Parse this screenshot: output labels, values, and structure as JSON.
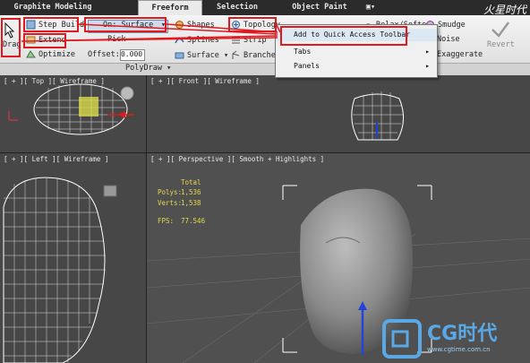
{
  "tabs": [
    {
      "label": "Graphite Modeling Tools",
      "active": false
    },
    {
      "label": "Freeform",
      "active": true
    },
    {
      "label": "Selection",
      "active": false
    },
    {
      "label": "Object Paint",
      "active": false
    }
  ],
  "ribbon": {
    "drag_label": "Drag",
    "step_build_label": "Step Build",
    "extend_label": "Extend",
    "optimize_label": "Optimize",
    "on_surface_value": "On: Surface",
    "pick_label": "Pick",
    "offset_label": "Offset:",
    "offset_value": "0.000",
    "shapes_label": "Shapes",
    "splines_label": "Splines",
    "surface_label": "Surface",
    "topology_label": "Topology",
    "strip_label": "Strip",
    "branches_label": "Branches",
    "relax_soften_label": "Relax/Soften",
    "smudge_label": "Smudge",
    "noise_label": "Noise",
    "exaggerate_label": "Exaggerate",
    "revert_label": "Revert",
    "panel_title": "PolyDraw"
  },
  "context_menu": {
    "items": [
      {
        "label": "Add to Quick Access Toolbar",
        "submenu": false
      },
      {
        "label": "Tabs",
        "submenu": true
      },
      {
        "label": "Panels",
        "submenu": true
      }
    ]
  },
  "viewports": {
    "top": "[ + ][ Top ][ Wireframe ]",
    "front": "[ + ][ Front ][ Wireframe ]",
    "left": "[ + ][ Left ][ Wireframe ]",
    "perspective": "[ + ][ Perspective ][ Smooth + Highlights ]"
  },
  "stats": {
    "total_label": "Total",
    "polys_label": "Polys:",
    "polys_value": "1,536",
    "verts_label": "Verts:",
    "verts_value": "1,538",
    "fps_label": "FPS:",
    "fps_value": "77.546"
  },
  "watermark": {
    "top_right": "火星时代",
    "logo_text": "CG时代",
    "url": "www.cgtime.com.cn"
  },
  "colors": {
    "highlight": "#e0191f",
    "viewport_bg": "#474747",
    "stat_text": "#e8d84a"
  }
}
